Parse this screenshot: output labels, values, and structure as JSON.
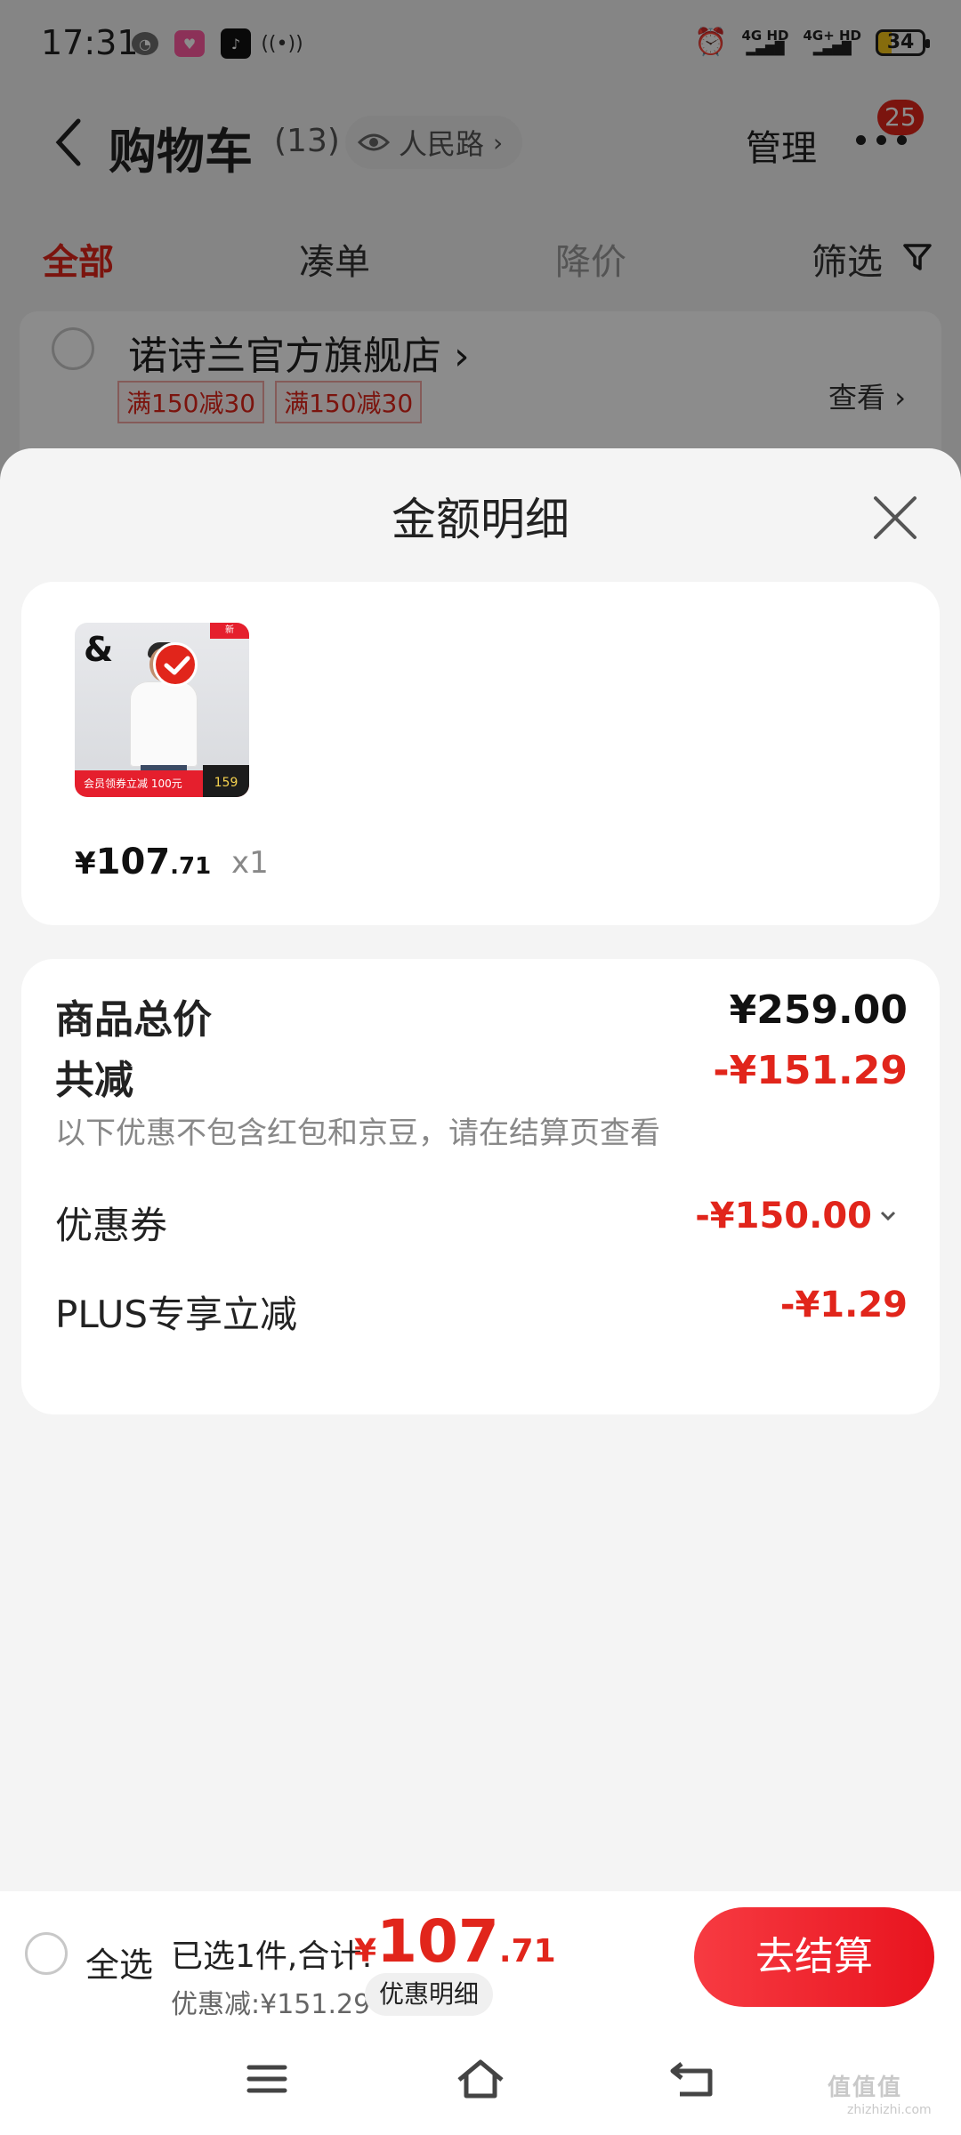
{
  "status_bar": {
    "time": "17:31",
    "network_1": "4G HD",
    "network_2": "4G+ HD",
    "battery": "34"
  },
  "header": {
    "title": "购物车",
    "count": "(13)",
    "location": "人民路",
    "manage": "管理",
    "badge": "25"
  },
  "tabs": [
    {
      "label": "全部",
      "state": "active"
    },
    {
      "label": "凑单",
      "state": "normal"
    },
    {
      "label": "降价",
      "state": "disabled"
    },
    {
      "label": "筛选",
      "state": "normal"
    }
  ],
  "store": {
    "name": "诺诗兰官方旗舰店",
    "promos": [
      "满150减30",
      "满150减30"
    ],
    "view": "查看"
  },
  "sheet": {
    "title": "金额明细",
    "product": {
      "thumb_logo": "&",
      "thumb_band": "会员领券立减 100元",
      "thumb_price": "159",
      "price_symbol": "¥",
      "price_int": "107",
      "price_dec": ".71",
      "quantity": "x1"
    },
    "summary": {
      "total_label": "商品总价",
      "total_value": "¥259.00",
      "reduce_label": "共减",
      "reduce_value": "-¥151.29",
      "reduce_note": "以下优惠不包含红包和京豆，请在结算页查看",
      "coupon_label": "优惠券",
      "coupon_value": "-¥150.00",
      "plus_label": "PLUS专享立减",
      "plus_value": "-¥1.29"
    }
  },
  "bottom_bar": {
    "select_all": "全选",
    "selected_text": "已选1件,合计:",
    "total_symbol": "¥",
    "total_int": "107",
    "total_dec": ".71",
    "discount_text": "优惠减:¥151.29",
    "detail_button": "优惠明细",
    "checkout": "去结算"
  },
  "watermark": {
    "text": "值值值",
    "sub": "zhizhizhi.com"
  },
  "colors": {
    "accent": "#e1251b",
    "overlay": "rgba(0,0,0,0.45)"
  }
}
